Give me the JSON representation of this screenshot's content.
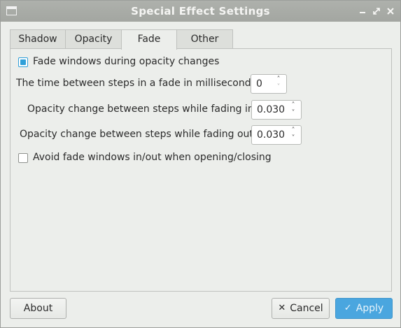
{
  "window": {
    "title": "Special Effect Settings"
  },
  "tabs": [
    {
      "label": "Shadow",
      "active": false
    },
    {
      "label": "Opacity",
      "active": false
    },
    {
      "label": "Fade",
      "active": true
    },
    {
      "label": "Other",
      "active": false
    }
  ],
  "fade": {
    "fade_windows": {
      "label": "Fade windows during opacity changes",
      "checked": true
    },
    "steps_time": {
      "label": "The time between steps in a fade in milliseconds",
      "value": "0"
    },
    "opacity_in": {
      "label": "Opacity change between steps while fading in",
      "value": "0.030"
    },
    "opacity_out": {
      "label": "Opacity change between steps while fading out",
      "value": "0.030"
    },
    "avoid_fade": {
      "label": "Avoid fade windows in/out when opening/closing",
      "checked": false
    }
  },
  "buttons": {
    "about": "About",
    "cancel": "Cancel",
    "apply": "Apply"
  },
  "icons": {
    "window": "window-icon",
    "minimize": "minimize-icon",
    "restore": "restore-icon",
    "close": "close-icon",
    "cancel": "x-icon",
    "apply": "checkmark-icon"
  },
  "colors": {
    "accent": "#4aa6df",
    "titlebar": "#a9aca7",
    "check": "#2f9fd8"
  }
}
